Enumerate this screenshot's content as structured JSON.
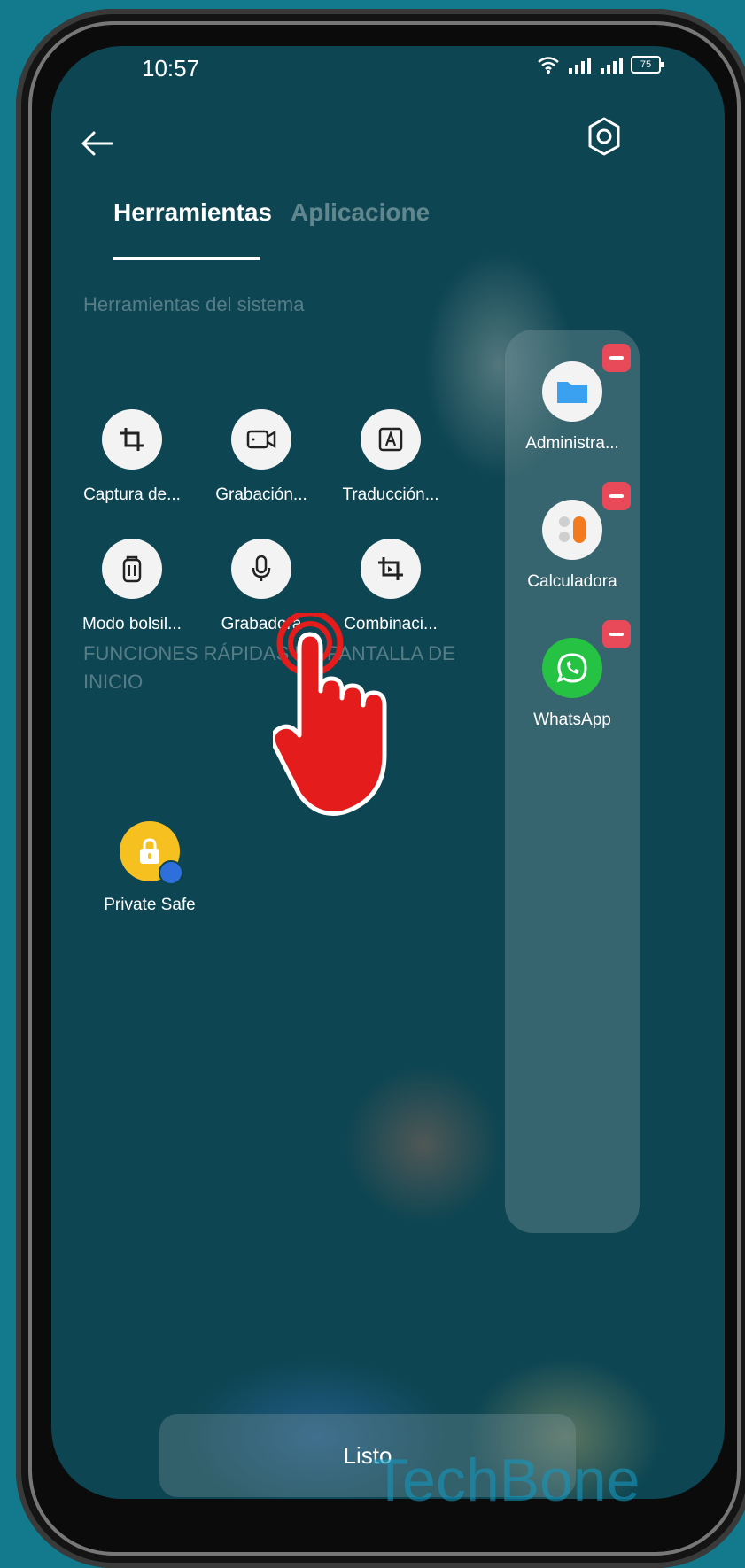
{
  "status": {
    "time": "10:57",
    "battery": "75"
  },
  "tabs": [
    {
      "label": "Herramientas"
    },
    {
      "label": "Aplicacione"
    }
  ],
  "sections": {
    "system_tools": "Herramientas del sistema",
    "home_shortcuts": "FUNCIONES RÁPIDAS DE PANTALLA DE INICIO"
  },
  "tools": [
    {
      "label": "Captura de...",
      "icon": "crop-icon"
    },
    {
      "label": "Grabación...",
      "icon": "video-record-icon"
    },
    {
      "label": "Traducción...",
      "icon": "translate-icon"
    },
    {
      "label": "Modo bolsil...",
      "icon": "pocket-icon"
    },
    {
      "label": "Grabadora",
      "icon": "microphone-icon"
    },
    {
      "label": "Combinaci...",
      "icon": "combine-crop-icon"
    }
  ],
  "sidebar_apps": [
    {
      "label": "Administra...",
      "icon": "folder-icon",
      "color": "#3aa0f0"
    },
    {
      "label": "Calculadora",
      "icon": "calculator-icon",
      "color": "#f47a20"
    },
    {
      "label": "WhatsApp",
      "icon": "whatsapp-icon",
      "color": "#25c244"
    }
  ],
  "home_items": [
    {
      "label": "Private Safe",
      "icon": "lock-icon",
      "color": "#f6c120"
    }
  ],
  "done_button": "Listo",
  "watermark": "TechBone"
}
